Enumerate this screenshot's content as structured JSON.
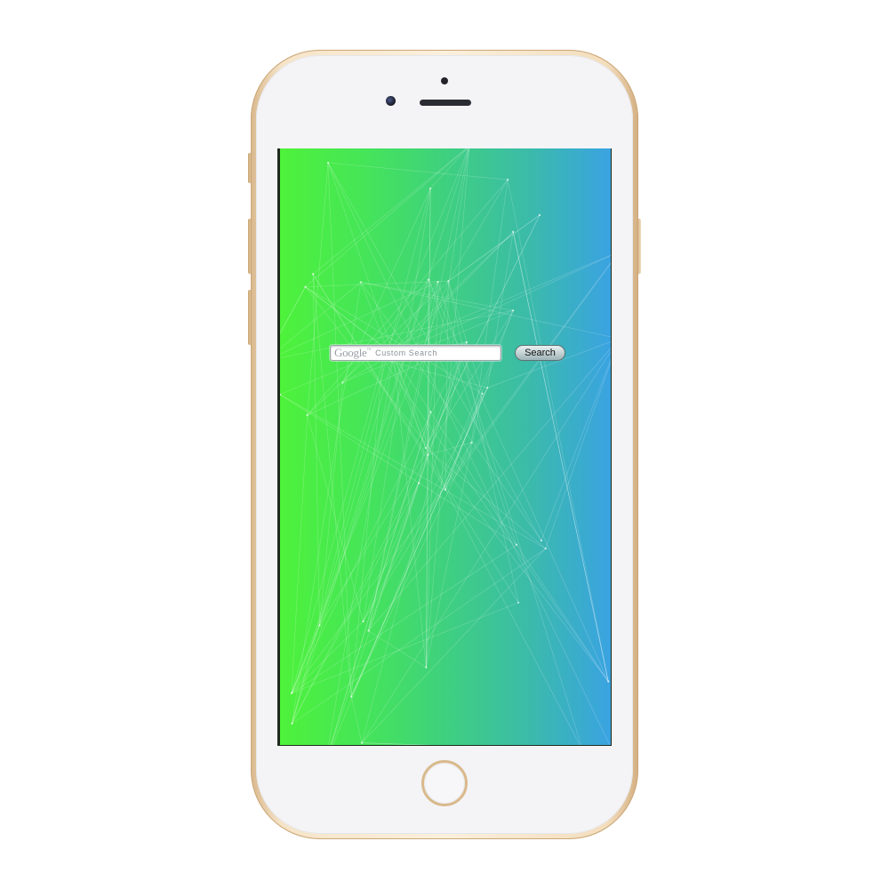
{
  "device": {
    "model": "iPhone",
    "color": "gold",
    "frame_color": "#f3dfc1",
    "face_color": "#f4f4f6"
  },
  "screen": {
    "background_gradient": [
      "#4ef23a",
      "#3fd07f",
      "#3aa3e2"
    ],
    "pattern": "network-mesh"
  },
  "search": {
    "logo_text": "Google",
    "logo_tm": "™",
    "label": "Custom Search",
    "value": "",
    "button_label": "Search"
  },
  "icons": {
    "front_camera": "camera-icon",
    "speaker": "speaker-grille",
    "home": "home-button"
  }
}
